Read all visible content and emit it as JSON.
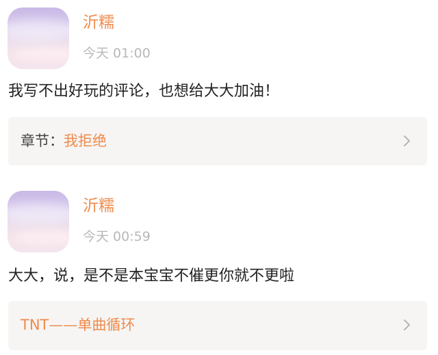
{
  "comments": [
    {
      "username": "沂糯",
      "timestamp": "今天 01:00",
      "text": "我写不出好玩的评论，也想给大大加油！",
      "chapter_prefix": "章节：",
      "chapter_title": "我拒绝"
    },
    {
      "username": "沂糯",
      "timestamp": "今天 00:59",
      "text": "大大，说，是不是本宝宝不催更你就不更啦",
      "chapter_prefix": "",
      "chapter_title": "TNT——单曲循环"
    }
  ],
  "colors": {
    "accent": "#ef8a4b",
    "timestamp": "#b8b8b8",
    "card_bg": "#f6f5f3",
    "text": "#222222"
  },
  "icons": {
    "chevron": "chevron-right-icon"
  }
}
